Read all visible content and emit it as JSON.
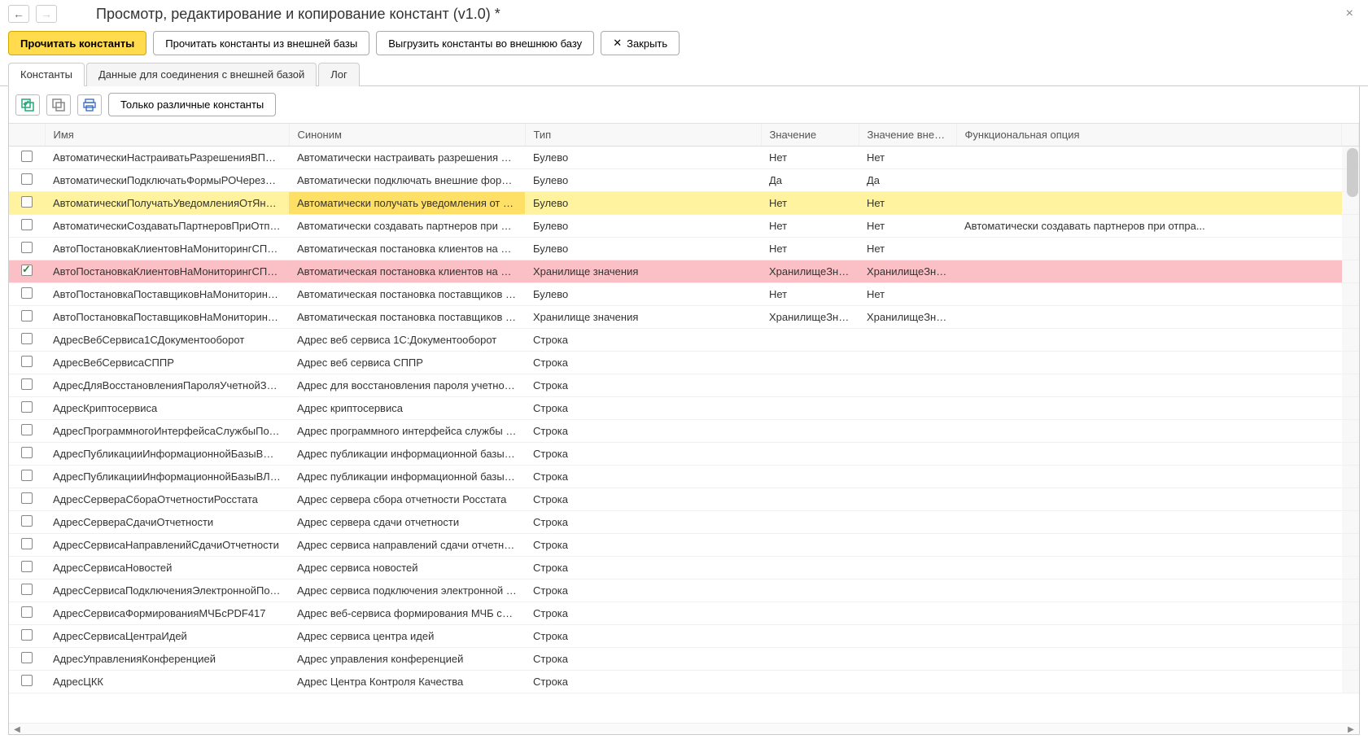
{
  "title": "Просмотр, редактирование и копирование констант (v1.0) *",
  "nav": {
    "back": "←",
    "forward": "→"
  },
  "close_x": "×",
  "toolbar": {
    "read_constants": "Прочитать константы",
    "read_external": "Прочитать константы из внешней базы",
    "export_external": "Выгрузить константы во внешнюю базу",
    "close": "Закрыть",
    "close_icon": "✕"
  },
  "tabs": {
    "constants": "Константы",
    "connection": "Данные для соединения с внешней базой",
    "log": "Лог"
  },
  "panel_toolbar": {
    "only_different": "Только различные константы"
  },
  "columns": {
    "check": "",
    "name": "Имя",
    "synonym": "Синоним",
    "type": "Тип",
    "value": "Значение",
    "ext_value": "Значение внеш...",
    "func_opt": "Функциональная опция"
  },
  "rows": [
    {
      "checked": false,
      "name": "АвтоматическиНастраиватьРазрешенияВПрофил...",
      "synonym": "Автоматически настраивать разрешения в про...",
      "type": "Булево",
      "value": "Нет",
      "ext_value": "Нет",
      "func_opt": "",
      "hl": ""
    },
    {
      "checked": false,
      "name": "АвтоматическиПодключатьФормыРОЧерезМеха...",
      "synonym": "Автоматически подключать внешние формы р...",
      "type": "Булево",
      "value": "Да",
      "ext_value": "Да",
      "func_opt": "",
      "hl": ""
    },
    {
      "checked": false,
      "name": "АвтоматическиПолучатьУведомленияОтЯндексК...",
      "synonym": "Автоматически получать уведомления от янде...",
      "type": "Булево",
      "value": "Нет",
      "ext_value": "Нет",
      "func_opt": "",
      "hl": "yellow"
    },
    {
      "checked": false,
      "name": "АвтоматическиСоздаватьПартнеровПриОтправке...",
      "synonym": "Автоматически создавать партнеров при отпр...",
      "type": "Булево",
      "value": "Нет",
      "ext_value": "Нет",
      "func_opt": "Автоматически создавать партнеров при отпра...",
      "hl": ""
    },
    {
      "checked": false,
      "name": "АвтоПостановкаКлиентовНаМониторингСПАРК",
      "synonym": "Автоматическая постановка клиентов на мони...",
      "type": "Булево",
      "value": "Нет",
      "ext_value": "Нет",
      "func_opt": "",
      "hl": ""
    },
    {
      "checked": true,
      "name": "АвтоПостановкаКлиентовНаМониторингСПАРКН...",
      "synonym": "Автоматическая постановка клиентов на мони...",
      "type": "Хранилище значения",
      "value": "ХранилищеЗна...",
      "ext_value": "ХранилищеЗна...",
      "func_opt": "",
      "hl": "pink"
    },
    {
      "checked": false,
      "name": "АвтоПостановкаПоставщиковНаМониторингСПАРК",
      "synonym": "Автоматическая постановка поставщиков на ...",
      "type": "Булево",
      "value": "Нет",
      "ext_value": "Нет",
      "func_opt": "",
      "hl": ""
    },
    {
      "checked": false,
      "name": "АвтоПостановкаПоставщиковНаМониторингСПА...",
      "synonym": "Автоматическая постановка поставщиков на ...",
      "type": "Хранилище значения",
      "value": "ХранилищеЗна...",
      "ext_value": "ХранилищеЗна...",
      "func_opt": "",
      "hl": ""
    },
    {
      "checked": false,
      "name": "АдресВебСервиса1СДокументооборот",
      "synonym": "Адрес веб сервиса 1С:Документооборот",
      "type": "Строка",
      "value": "",
      "ext_value": "",
      "func_opt": "",
      "hl": ""
    },
    {
      "checked": false,
      "name": "АдресВебСервисаСППР",
      "synonym": "Адрес веб сервиса СППР",
      "type": "Строка",
      "value": "",
      "ext_value": "",
      "func_opt": "",
      "hl": ""
    },
    {
      "checked": false,
      "name": "АдресДляВосстановленияПароляУчетнойЗаписи",
      "synonym": "Адрес для восстановления пароля учетной за...",
      "type": "Строка",
      "value": "",
      "ext_value": "",
      "func_opt": "",
      "hl": ""
    },
    {
      "checked": false,
      "name": "АдресКриптосервиса",
      "synonym": "Адрес криптосервиса",
      "type": "Строка",
      "value": "",
      "ext_value": "",
      "func_opt": "",
      "hl": ""
    },
    {
      "checked": false,
      "name": "АдресПрограммногоИнтерфейсаСлужбыПоддер...",
      "synonym": "Адрес программного интерфейса службы под...",
      "type": "Строка",
      "value": "",
      "ext_value": "",
      "func_opt": "",
      "hl": ""
    },
    {
      "checked": false,
      "name": "АдресПубликацииИнформационнойБазыВИнтерн...",
      "synonym": "Адрес публикации информационной базы в ин...",
      "type": "Строка",
      "value": "",
      "ext_value": "",
      "func_opt": "",
      "hl": ""
    },
    {
      "checked": false,
      "name": "АдресПубликацииИнформационнойБазыВЛокаль...",
      "synonym": "Адрес публикации информационной базы в ло...",
      "type": "Строка",
      "value": "",
      "ext_value": "",
      "func_opt": "",
      "hl": ""
    },
    {
      "checked": false,
      "name": "АдресСервераСбораОтчетностиРосстата",
      "synonym": "Адрес сервера сбора отчетности Росстата",
      "type": "Строка",
      "value": "",
      "ext_value": "",
      "func_opt": "",
      "hl": ""
    },
    {
      "checked": false,
      "name": "АдресСервераСдачиОтчетности",
      "synonym": "Адрес сервера сдачи отчетности",
      "type": "Строка",
      "value": "",
      "ext_value": "",
      "func_opt": "",
      "hl": ""
    },
    {
      "checked": false,
      "name": "АдресСервисаНаправленийСдачиОтчетности",
      "synonym": "Адрес сервиса направлений сдачи отчетности",
      "type": "Строка",
      "value": "",
      "ext_value": "",
      "func_opt": "",
      "hl": ""
    },
    {
      "checked": false,
      "name": "АдресСервисаНовостей",
      "synonym": "Адрес сервиса новостей",
      "type": "Строка",
      "value": "",
      "ext_value": "",
      "func_opt": "",
      "hl": ""
    },
    {
      "checked": false,
      "name": "АдресСервисаПодключенияЭлектроннойПодпис...",
      "synonym": "Адрес сервиса подключения электронной под...",
      "type": "Строка",
      "value": "",
      "ext_value": "",
      "func_opt": "",
      "hl": ""
    },
    {
      "checked": false,
      "name": "АдресСервисаФормированияМЧБсPDF417",
      "synonym": "Адрес веб-сервиса формирования МЧБ со шт...",
      "type": "Строка",
      "value": "",
      "ext_value": "",
      "func_opt": "",
      "hl": ""
    },
    {
      "checked": false,
      "name": "АдресСервисаЦентраИдей",
      "synonym": "Адрес сервиса центра идей",
      "type": "Строка",
      "value": "",
      "ext_value": "",
      "func_opt": "",
      "hl": ""
    },
    {
      "checked": false,
      "name": "АдресУправленияКонференцией",
      "synonym": "Адрес управления конференцией",
      "type": "Строка",
      "value": "",
      "ext_value": "",
      "func_opt": "",
      "hl": ""
    },
    {
      "checked": false,
      "name": "АдресЦКК",
      "synonym": "Адрес Центра Контроля Качества",
      "type": "Строка",
      "value": "",
      "ext_value": "",
      "func_opt": "",
      "hl": ""
    }
  ]
}
